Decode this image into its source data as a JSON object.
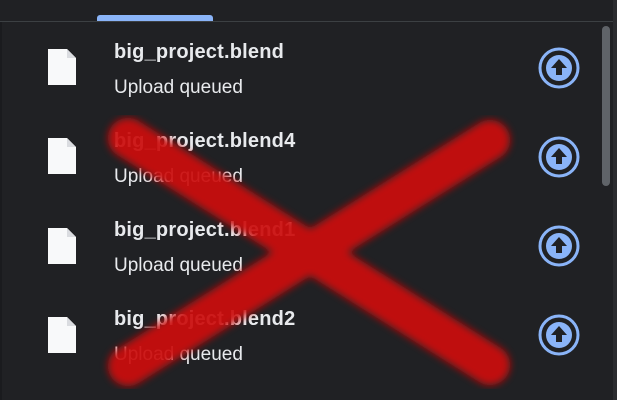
{
  "downloads": {
    "items": [
      {
        "filename": "big_project.blend",
        "status": "Upload queued",
        "icon": "file-icon",
        "action_icon": "upload-icon"
      },
      {
        "filename": "big_project.blend4",
        "status": "Upload queued",
        "icon": "file-icon",
        "action_icon": "upload-icon"
      },
      {
        "filename": "big_project.blend1",
        "status": "Upload queued",
        "icon": "file-icon",
        "action_icon": "upload-icon"
      },
      {
        "filename": "big_project.blend2",
        "status": "Upload queued",
        "icon": "file-icon",
        "action_icon": "upload-icon"
      }
    ]
  },
  "overlay": {
    "mark": "red-x-cross",
    "color": "#cc1111"
  },
  "colors": {
    "background": "#202124",
    "text": "#e8eaed",
    "accent": "#8ab4f8",
    "scrollbar": "#5f6368"
  }
}
